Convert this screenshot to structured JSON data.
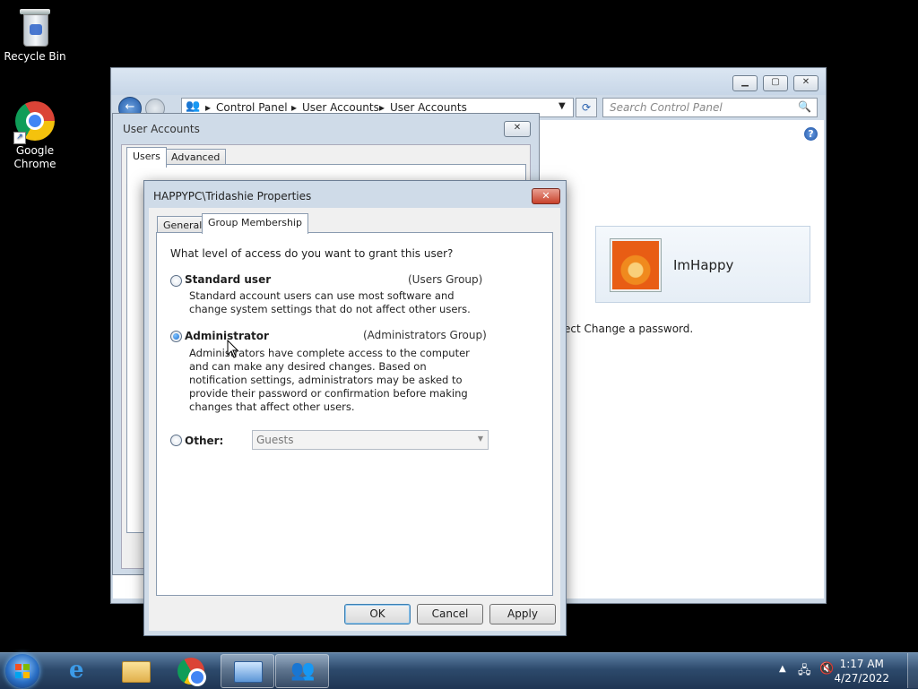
{
  "desktop": {
    "icons": [
      {
        "label": "Recycle Bin",
        "icon": "recycle-bin-icon"
      },
      {
        "label": "Google Chrome",
        "icon": "chrome-icon"
      }
    ]
  },
  "control_panel": {
    "breadcrumb": [
      "Control Panel",
      "User Accounts",
      "User Accounts"
    ],
    "search_placeholder": "Search Control Panel",
    "user_card": {
      "name": "ImHappy"
    },
    "hint_text": "ect Change a password."
  },
  "user_accounts_dialog": {
    "title": "User Accounts",
    "tabs": [
      "Users",
      "Advanced"
    ]
  },
  "properties_dialog": {
    "title": "HAPPYPC\\Tridashie Properties",
    "tabs": [
      "General",
      "Group Membership"
    ],
    "question": "What level of access do you want to grant this user?",
    "options": [
      {
        "title": "Standard user",
        "group": "(Users Group)",
        "checked": false,
        "desc": "Standard account users can use most software and change system settings that do not affect other users."
      },
      {
        "title": "Administrator",
        "group": "(Administrators Group)",
        "checked": true,
        "desc": "Administrators have complete access to the computer and can make any desired changes. Based on notification settings, administrators may be asked to provide their password or confirmation before making changes that affect other users."
      },
      {
        "title": "Other:",
        "checked": false,
        "select_value": "Guests"
      }
    ],
    "buttons": {
      "ok": "OK",
      "cancel": "Cancel",
      "apply": "Apply"
    }
  },
  "taskbar": {
    "time": "1:17 AM",
    "date": "4/27/2022"
  },
  "colors": {
    "accent": "#1f6fcf",
    "taskbar": "#2d4a6c"
  }
}
